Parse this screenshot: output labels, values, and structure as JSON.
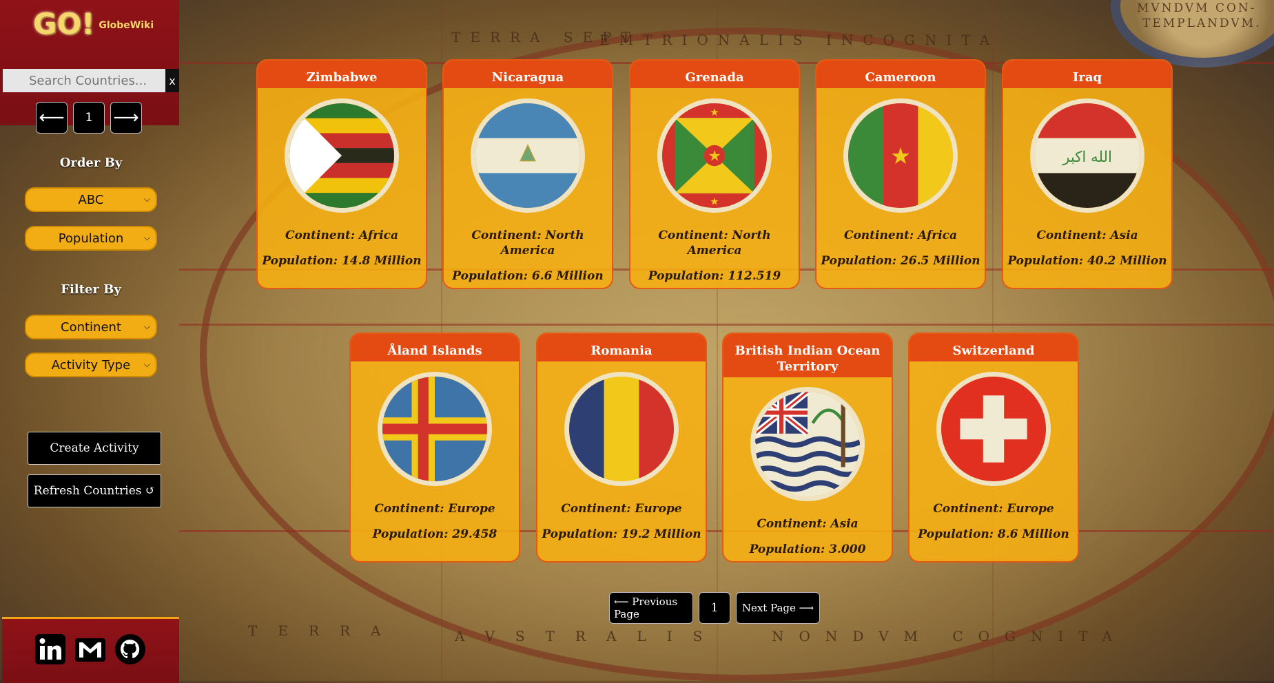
{
  "app": {
    "logo_main": "GO!",
    "logo_sub": "GlobeWiki"
  },
  "search": {
    "placeholder": "Search Countries...",
    "clear_label": "x"
  },
  "sidebar_pager": {
    "prev": "⟵",
    "page": "1",
    "next": "⟶"
  },
  "order_by": {
    "label": "Order By",
    "alpha": "ABC",
    "population": "Population"
  },
  "filter_by": {
    "label": "Filter By",
    "continent": "Continent",
    "activity": "Activity Type"
  },
  "actions": {
    "create": "Create Activity",
    "refresh": "Refresh Countries ↺"
  },
  "map_labels": [
    "TERRA SEPT",
    "EMTRIONALIS INCOGNITA",
    "TERRA",
    "AVSTRALIS",
    "NONDVM COGNITA",
    "MVNDVM CON-",
    "TEMPLANDVM."
  ],
  "countries": [
    {
      "name": "Zimbabwe",
      "continent": "Continent: Africa",
      "population": "Population: 14.8 Million",
      "flag": "zimbabwe"
    },
    {
      "name": "Nicaragua",
      "continent": "Continent: North America",
      "population": "Population: 6.6 Million",
      "flag": "nicaragua"
    },
    {
      "name": "Grenada",
      "continent": "Continent: North America",
      "population": "Population: 112.519",
      "flag": "grenada"
    },
    {
      "name": "Cameroon",
      "continent": "Continent: Africa",
      "population": "Population: 26.5 Million",
      "flag": "cameroon"
    },
    {
      "name": "Iraq",
      "continent": "Continent: Asia",
      "population": "Population: 40.2 Million",
      "flag": "iraq"
    },
    {
      "name": "Åland Islands",
      "continent": "Continent: Europe",
      "population": "Population: 29.458",
      "flag": "aland"
    },
    {
      "name": "Romania",
      "continent": "Continent: Europe",
      "population": "Population: 19.2 Million",
      "flag": "romania"
    },
    {
      "name": "British Indian Ocean Territory",
      "continent": "Continent: Asia",
      "population": "Population: 3.000",
      "flag": "biot"
    },
    {
      "name": "Switzerland",
      "continent": "Continent: Europe",
      "population": "Population: 8.6 Million",
      "flag": "switzerland"
    }
  ],
  "bottom_pager": {
    "prev": "⟵ Previous Page",
    "page": "1",
    "next": "Next Page ⟶"
  },
  "social": [
    "linkedin-icon",
    "gmail-icon",
    "github-icon"
  ],
  "colors": {
    "sidebar": "#8f1218",
    "card": "#f7af12",
    "card_header": "#e34b12"
  }
}
